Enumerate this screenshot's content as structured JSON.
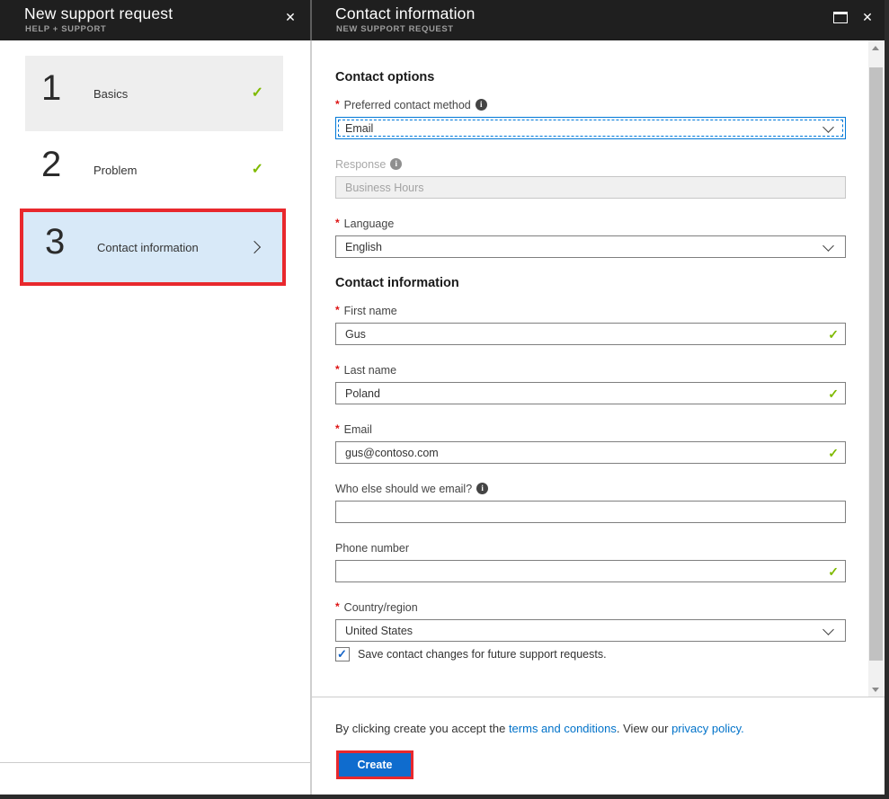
{
  "ui": {
    "required_marker": "*"
  },
  "icons": {
    "close": "✕",
    "check": "✓",
    "info": "i",
    "checkbox_check": "✓"
  },
  "colors": {
    "header_bg": "#1f1f1f",
    "accent_blue": "#0078d7",
    "link_blue": "#0072c9",
    "button_blue": "#0f6cce",
    "highlight_red": "#e8282d",
    "valid_green": "#7fba00",
    "active_step_bg": "#d8e9f8"
  },
  "left_panel": {
    "header": {
      "title": "New support request",
      "subtitle": "HELP + SUPPORT"
    },
    "steps": [
      {
        "number": "1",
        "label": "Basics",
        "status": "complete"
      },
      {
        "number": "2",
        "label": "Problem",
        "status": "complete"
      },
      {
        "number": "3",
        "label": "Contact information",
        "status": "current"
      }
    ]
  },
  "right_panel": {
    "header": {
      "title": "Contact information",
      "subtitle": "NEW SUPPORT REQUEST"
    },
    "form": {
      "contact_options_heading": "Contact options",
      "preferred_contact_method": {
        "label": "Preferred contact method",
        "value": "Email",
        "required": true,
        "focused": true
      },
      "response": {
        "label": "Response",
        "value": "Business Hours",
        "disabled": true
      },
      "language": {
        "label": "Language",
        "value": "English",
        "required": true
      },
      "contact_information_heading": "Contact information",
      "first_name": {
        "label": "First name",
        "value": "Gus",
        "required": true,
        "valid": true
      },
      "last_name": {
        "label": "Last name",
        "value": "Poland",
        "required": true,
        "valid": true
      },
      "email": {
        "label": "Email",
        "value": "gus@contoso.com",
        "required": true,
        "valid": true
      },
      "additional_email": {
        "label": "Who else should we email?",
        "value": ""
      },
      "phone_number": {
        "label": "Phone number",
        "value": "",
        "valid": true
      },
      "country_region": {
        "label": "Country/region",
        "value": "United States",
        "required": true
      },
      "save_contact_checkbox": {
        "label": "Save contact changes for future support requests.",
        "checked": true
      }
    },
    "footer": {
      "disclaimer_prefix": "By clicking create you accept the ",
      "terms_link": "terms and conditions",
      "disclaimer_middle": ". View our ",
      "privacy_link": "privacy policy",
      "disclaimer_suffix": ".",
      "create_button": "Create"
    }
  }
}
